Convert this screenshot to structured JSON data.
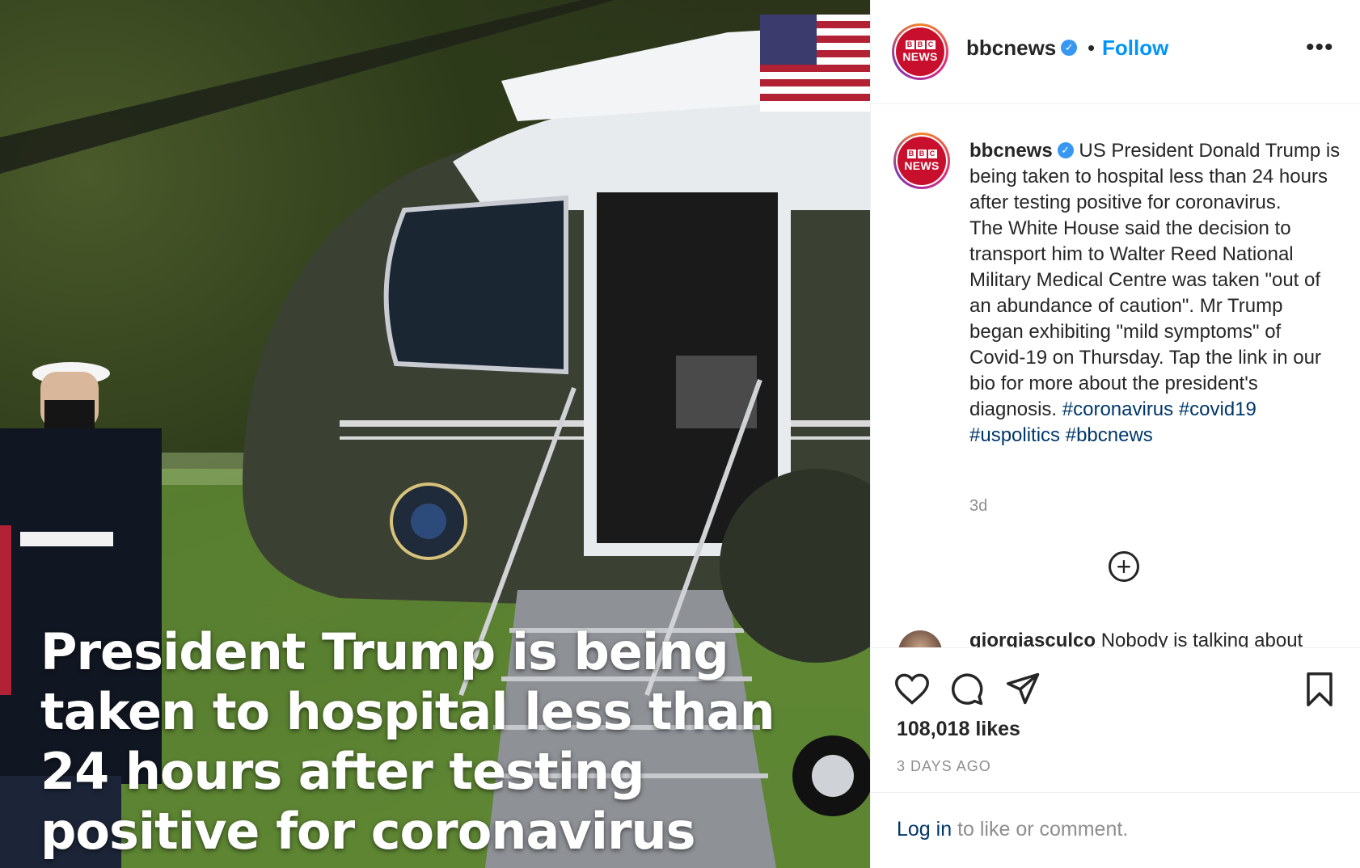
{
  "media": {
    "headline_overlay": "President Trump is being taken to hospital less than 24 hours after testing positive for coronavirus"
  },
  "header": {
    "avatar_logo_top": [
      "B",
      "B",
      "C"
    ],
    "avatar_logo_bottom": "NEWS",
    "username": "bbcnews",
    "verified": true,
    "separator": "•",
    "follow_label": "Follow",
    "more_icon": "more-options-icon"
  },
  "caption": {
    "username": "bbcnews",
    "text_line1": "US President Donald Trump is being taken to hospital less than 24 hours after testing positive for coronavirus.",
    "text_line2": "The White House said the decision to transport him to Walter Reed National Military Medical Centre was taken \"out of an abundance of caution\". Mr Trump began exhibiting \"mild symptoms\" of Covid-19 on Thursday. Tap the link in our bio for more about the president's diagnosis.",
    "hashtags": [
      "#coronavirus",
      "#covid19",
      "#uspolitics",
      "#bbcnews"
    ],
    "time": "3d"
  },
  "next_comment": {
    "username": "giorgiasculco",
    "text": "Nobody is talking about"
  },
  "actions": {
    "icons": [
      "heart-icon",
      "comment-icon",
      "share-icon",
      "bookmark-icon"
    ],
    "likes": "108,018 likes",
    "date": "3 DAYS AGO"
  },
  "login": {
    "link": "Log in",
    "rest": "to like or comment."
  },
  "colors": {
    "link_blue": "#0095f6",
    "hashtag_blue": "#00376b",
    "bbc_red": "#c8102e",
    "muted": "#8e8e8e"
  }
}
